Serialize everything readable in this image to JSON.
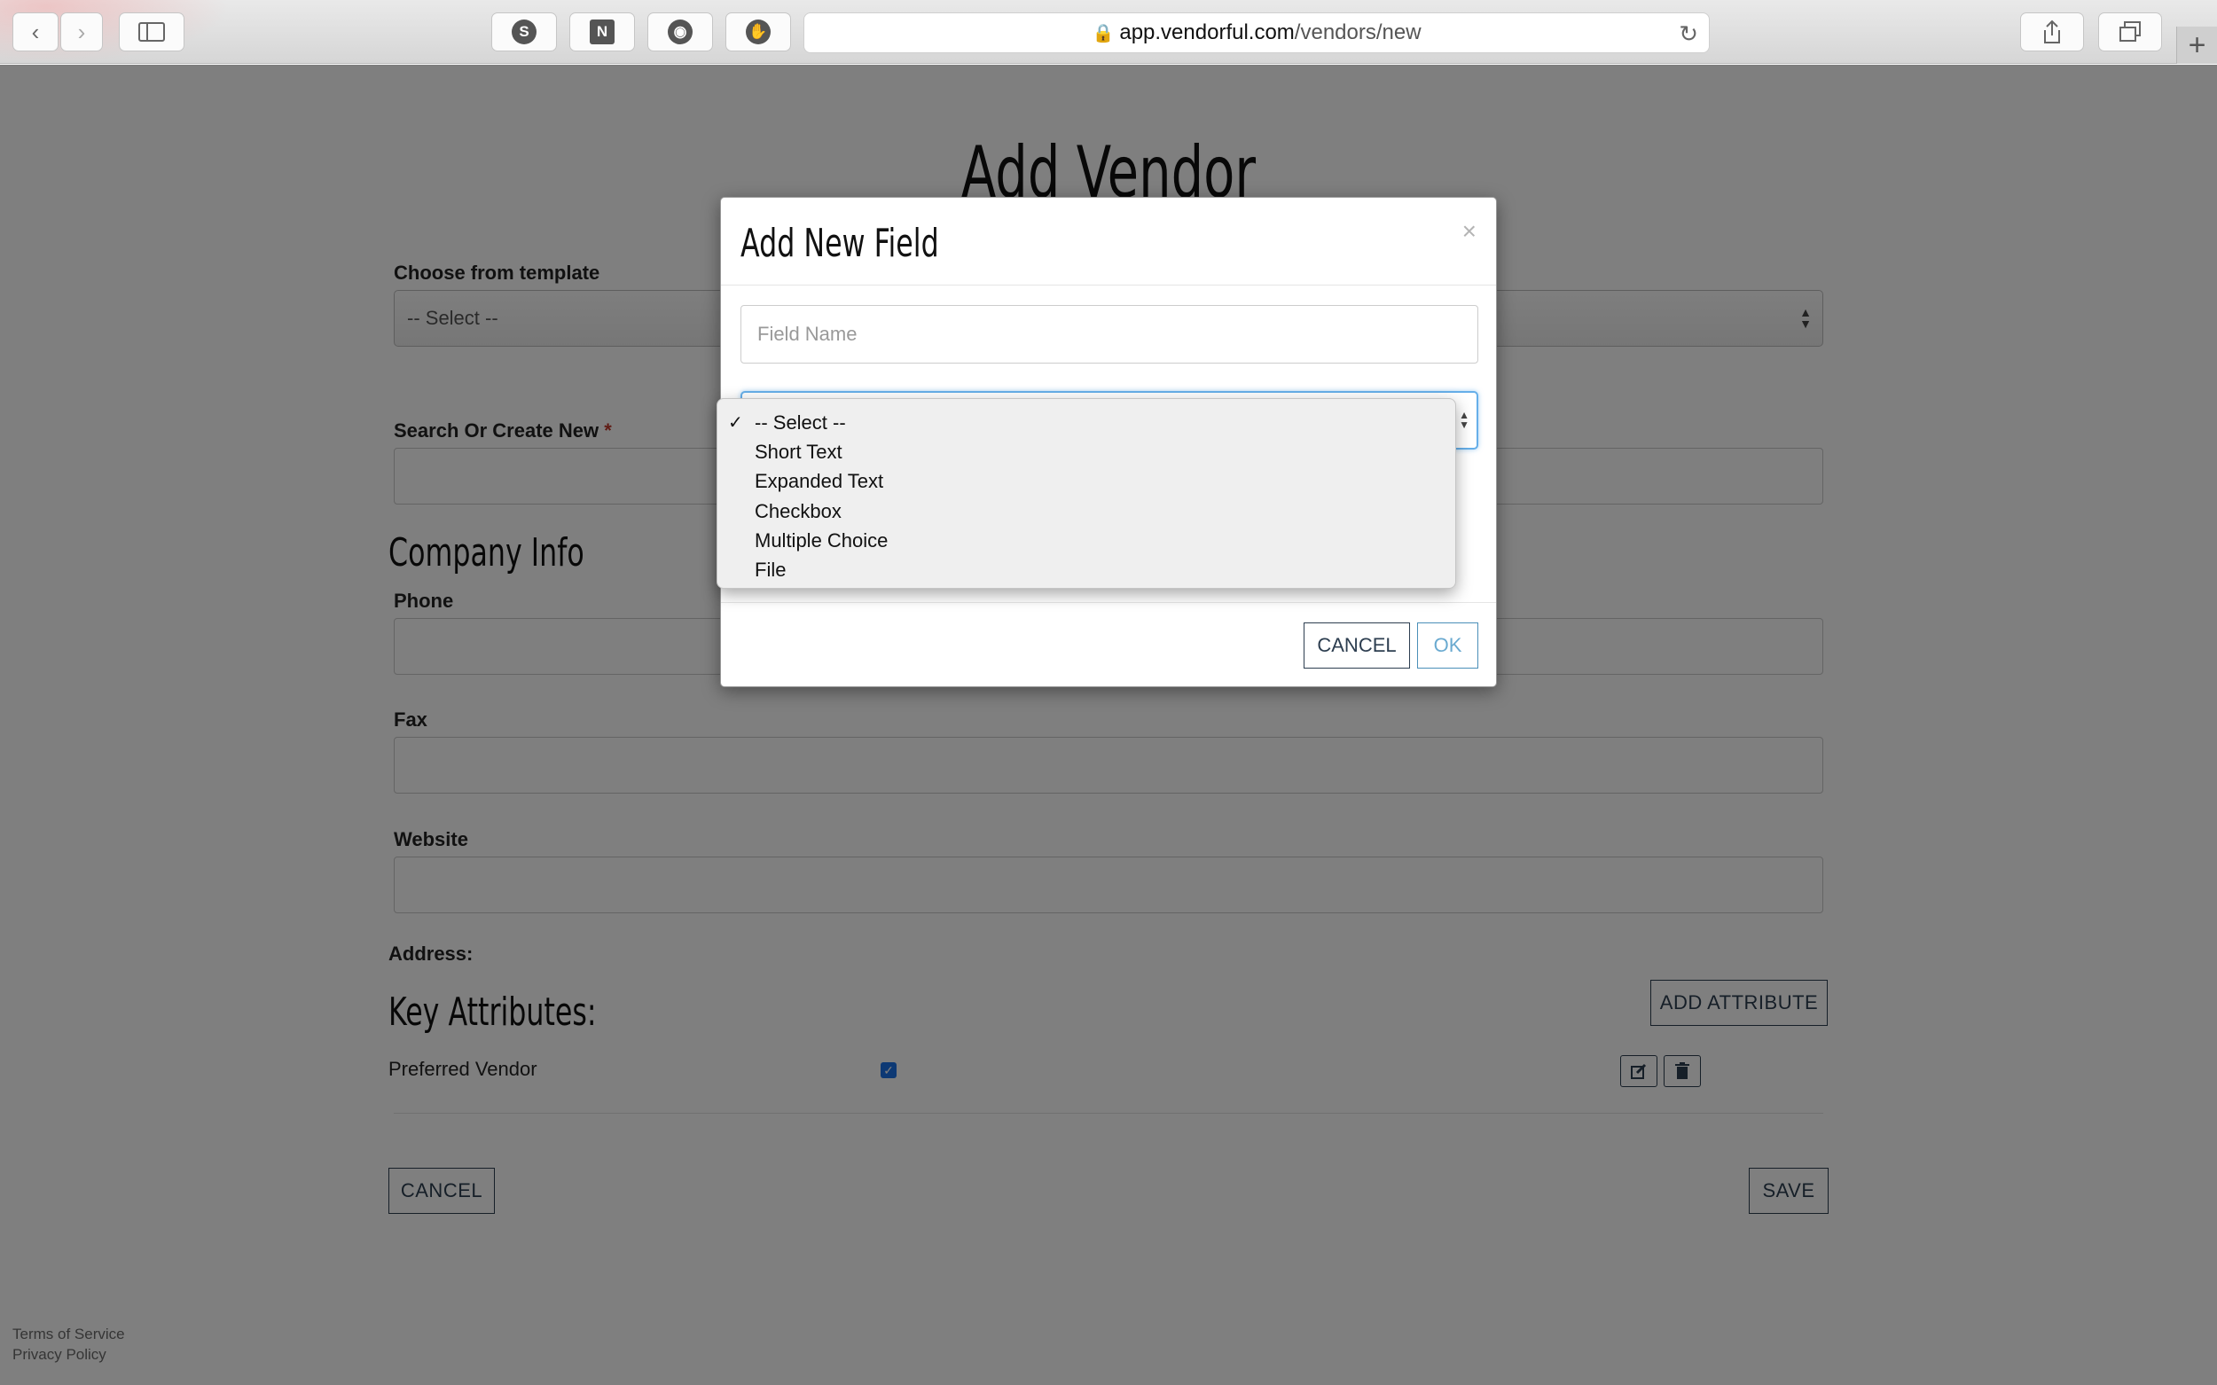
{
  "browser": {
    "url_domain": "app.vendorful.com",
    "url_path": "/vendors/new"
  },
  "page": {
    "title": "Add Vendor",
    "template_label": "Choose from template",
    "template_value": "-- Select --",
    "search_label": "Search Or Create New",
    "required_mark": "*",
    "company_heading": "Company Info",
    "phone_label": "Phone",
    "fax_label": "Fax",
    "website_label": "Website",
    "address_label": "Address:",
    "key_attributes_heading": "Key Attributes:",
    "add_attribute_button": "ADD ATTRIBUTE",
    "attributes": [
      {
        "name": "Preferred Vendor",
        "checked": true
      }
    ],
    "cancel_button": "CANCEL",
    "save_button": "SAVE",
    "footer": {
      "terms": "Terms of Service",
      "privacy": "Privacy Policy"
    }
  },
  "modal": {
    "title": "Add New Field",
    "close": "×",
    "field_name_placeholder": "Field Name",
    "cancel_button": "CANCEL",
    "ok_button": "OK",
    "type_options": [
      "-- Select --",
      "Short Text",
      "Expanded Text",
      "Checkbox",
      "Multiple Choice",
      "File"
    ],
    "selected_index": 0,
    "selected_mark": "✓"
  },
  "colors": {
    "accent": "#2d3e50",
    "focus": "#66afe9",
    "required": "#c0392b",
    "overlay": "rgba(0,0,0,0.5)"
  }
}
